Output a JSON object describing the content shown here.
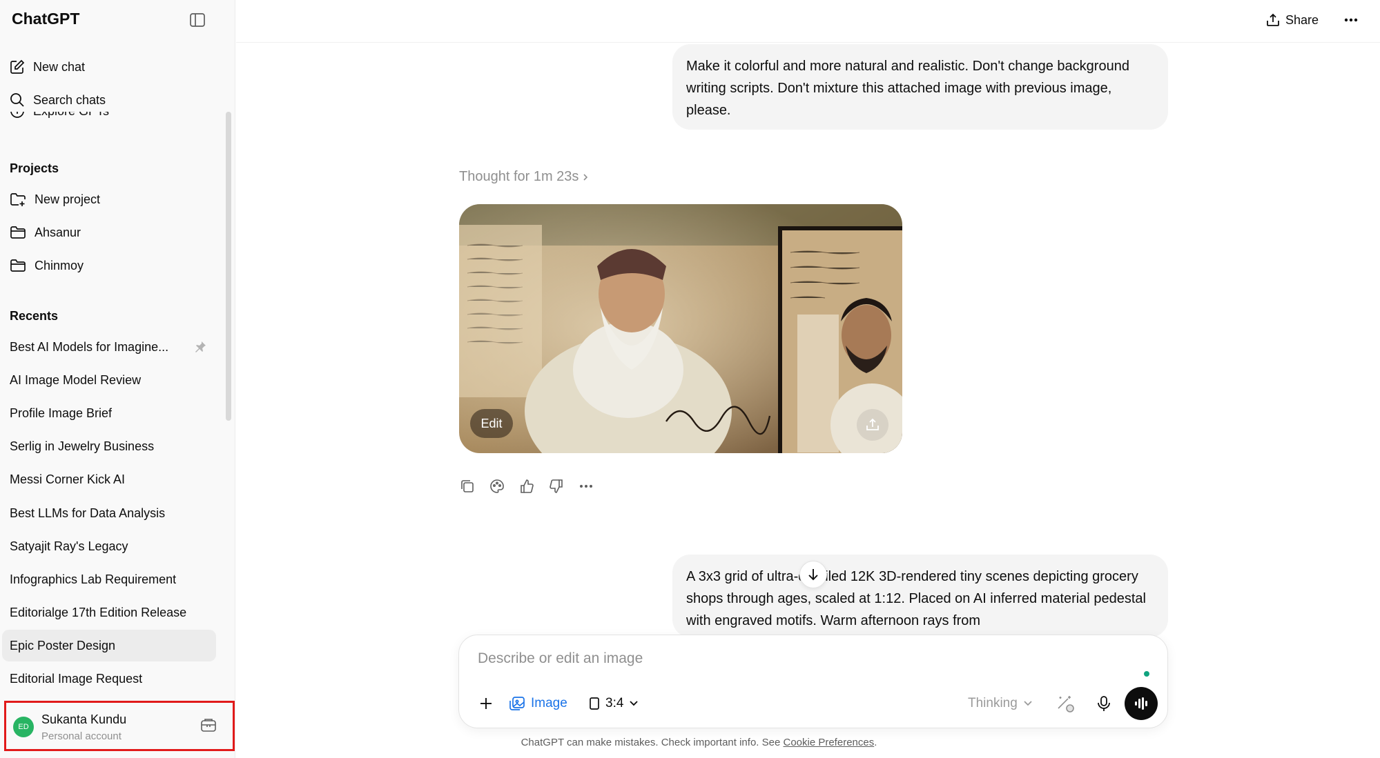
{
  "app": {
    "title": "ChatGPT"
  },
  "sidebar": {
    "new_chat": "New chat",
    "search_chats": "Search chats",
    "cut_item": "Explore GPTs",
    "projects_title": "Projects",
    "projects": [
      {
        "label": "New project",
        "icon": "folder-plus-icon"
      },
      {
        "label": "Ahsanur",
        "icon": "folder-icon"
      },
      {
        "label": "Chinmoy",
        "icon": "folder-icon"
      }
    ],
    "recents_title": "Recents",
    "recents": [
      "Best AI Models for Imagine...",
      "AI Image Model Review",
      "Profile Image Brief",
      "Serlig in Jewelry Business",
      "Messi Corner Kick AI",
      "Best LLMs for Data Analysis",
      "Satyajit Ray's Legacy",
      "Infographics Lab Requirement",
      "Editorialge 17th Edition Release",
      "Epic Poster Design",
      "Editorial Image Request"
    ],
    "active_recent": "Epic Poster Design",
    "account": {
      "initials": "ED",
      "name": "Sukanta Kundu",
      "subtitle": "Personal account"
    }
  },
  "header": {
    "share_label": "Share"
  },
  "conversation": {
    "user_message_1": "Make it colorful and more natural and realistic. Don't change background writing scripts. Don't mixture this attached image with previous image, please.",
    "thought_label": "Thought for 1m 23s",
    "image_edit_label": "Edit",
    "user_message_2": "A 3x3 grid of ultra-detailed 12K 3D-rendered tiny scenes depicting grocery shops through ages, scaled at 1:12. Placed on AI inferred material pedestal with engraved motifs. Warm afternoon rays from"
  },
  "composer": {
    "placeholder": "Describe or edit an image",
    "image_label": "Image",
    "ratio_label": "3:4",
    "model_label": "Thinking"
  },
  "footer": {
    "disclaimer_text": "ChatGPT can make mistakes. Check important info. See",
    "link_label": "Cookie Preferences",
    "end": "."
  },
  "colors": {
    "accent_blue": "#1a73e8",
    "highlight_red": "#e11a1a",
    "avatar_green": "#28b463"
  }
}
